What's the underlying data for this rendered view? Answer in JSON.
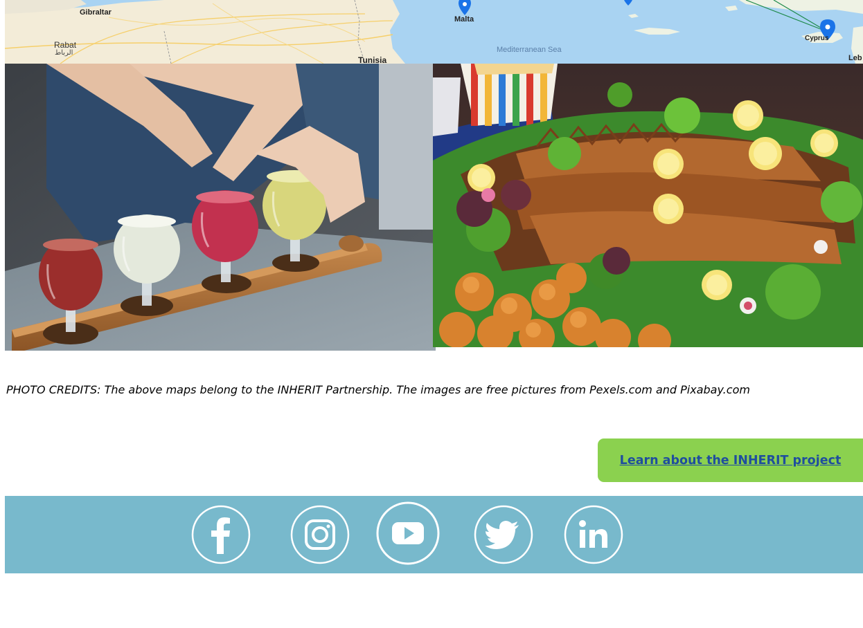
{
  "map": {
    "labels": {
      "gibraltar": "Gibraltar",
      "rabat": "Rabat",
      "rabat_ar": "الرباط",
      "tunisia": "Tunisia",
      "malta": "Malta",
      "sea": "Mediterranean Sea",
      "cyprus": "Cyprus",
      "lebanon_partial": "Leb"
    },
    "marker_color": "#1a73e8"
  },
  "photos": [
    {
      "subject": "beer-flight-photo"
    },
    {
      "subject": "fish-platter-photo"
    }
  ],
  "credits": {
    "text": "PHOTO CREDITS: The above maps belong to the INHERIT Partnership. The images are free pictures from Pexels.com and Pixabay.com"
  },
  "cta": {
    "label": "Learn about the INHERIT project",
    "bg_color": "#8bd14f",
    "link_color": "#1f4e9e"
  },
  "social": {
    "bar_color": "#78b9cc",
    "icons": [
      "facebook-icon",
      "instagram-icon",
      "youtube-icon",
      "twitter-icon",
      "linkedin-icon"
    ]
  }
}
